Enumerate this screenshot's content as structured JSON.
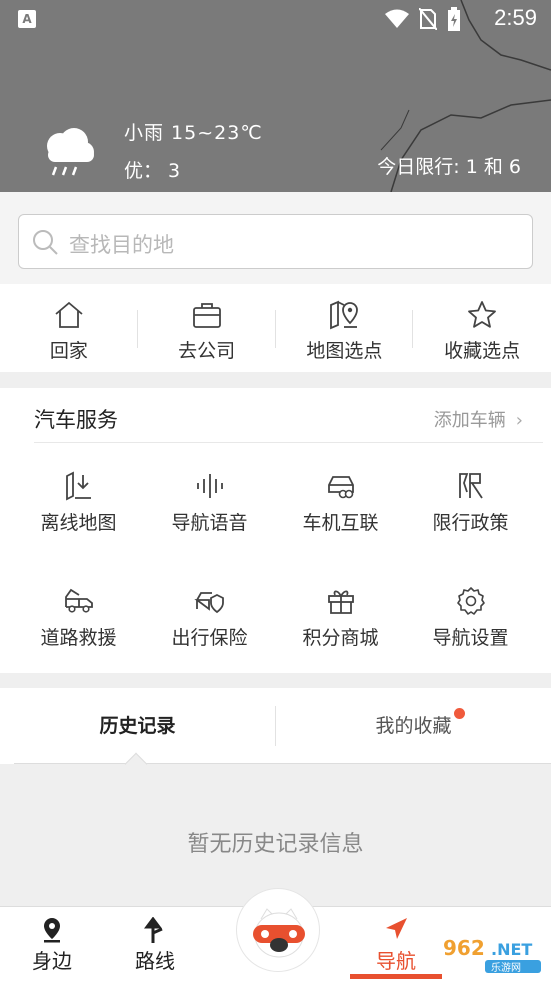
{
  "status_bar": {
    "time": "2:59",
    "left_icon": "A"
  },
  "weather": {
    "icon": "rain-cloud-icon",
    "description": "小雨   15~23℃",
    "aqi": "优：  3",
    "limit": "今日限行: 1 和 6"
  },
  "search": {
    "placeholder": "查找目的地"
  },
  "quick_actions": [
    {
      "label": "回家",
      "icon": "home-icon"
    },
    {
      "label": "去公司",
      "icon": "briefcase-icon"
    },
    {
      "label": "地图选点",
      "icon": "map-pin-icon"
    },
    {
      "label": "收藏选点",
      "icon": "star-icon"
    }
  ],
  "car_services": {
    "title": "汽车服务",
    "add_vehicle": "添加车辆",
    "items": [
      {
        "label": "离线地图",
        "icon": "offline-map-icon"
      },
      {
        "label": "导航语音",
        "icon": "voice-wave-icon"
      },
      {
        "label": "车机互联",
        "icon": "car-link-icon"
      },
      {
        "label": "限行政策",
        "icon": "restriction-icon"
      },
      {
        "label": "道路救援",
        "icon": "tow-truck-icon"
      },
      {
        "label": "出行保险",
        "icon": "car-shield-icon"
      },
      {
        "label": "积分商城",
        "icon": "gift-icon"
      },
      {
        "label": "导航设置",
        "icon": "settings-gear-icon"
      }
    ]
  },
  "tabs": {
    "history": "历史记录",
    "favorites": "我的收藏"
  },
  "empty_message": "暂无历史记录信息",
  "bottom_nav": [
    {
      "label": "身边",
      "icon": "location-pin-icon"
    },
    {
      "label": "路线",
      "icon": "route-arrow-icon"
    },
    {
      "label": "导航",
      "icon": "navigation-arrow-icon"
    }
  ],
  "watermark": "962 NET 乐游网",
  "colors": {
    "accent": "#e8502f",
    "header_bg": "#7a7a7a"
  }
}
